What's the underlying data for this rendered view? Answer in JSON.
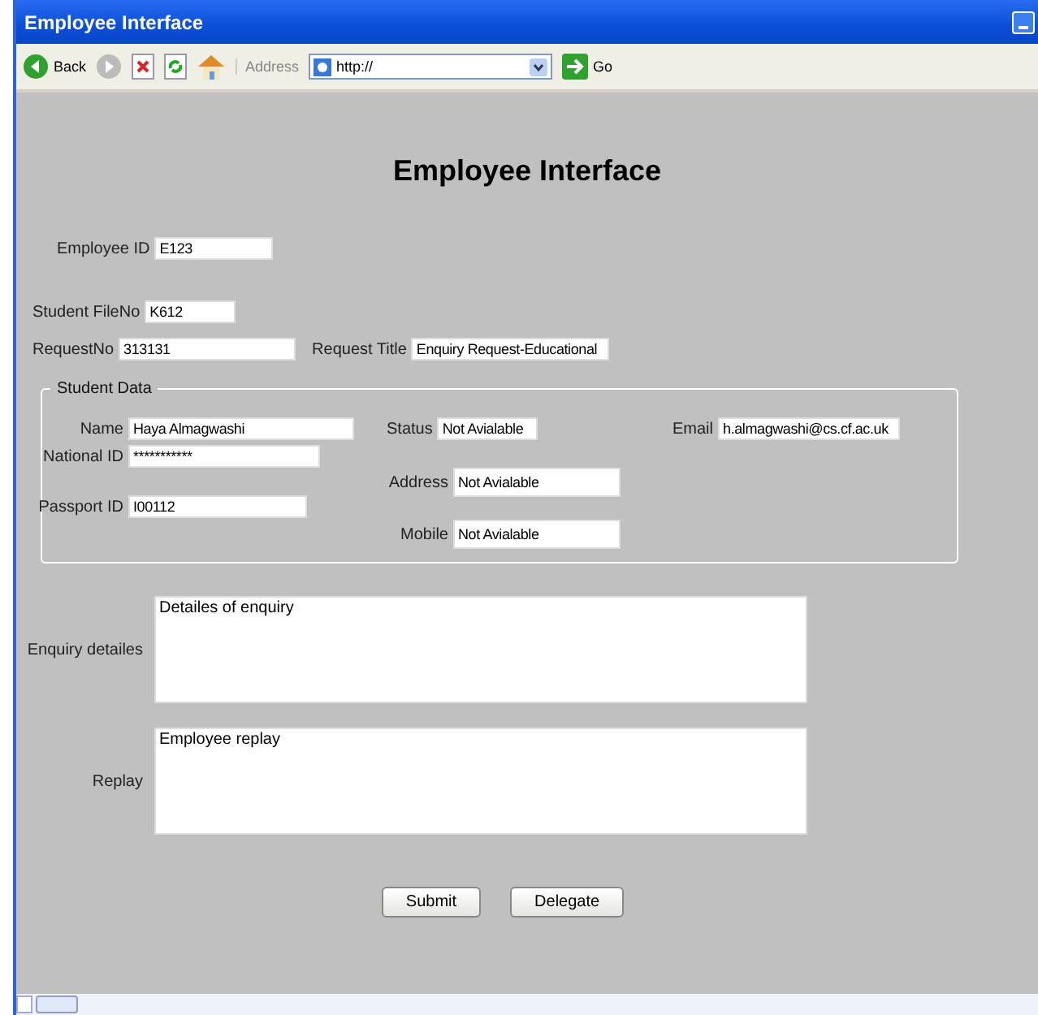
{
  "window": {
    "title": "Employee Interface"
  },
  "toolbar": {
    "back": "Back",
    "address_label": "Address",
    "address": "http://",
    "go": "Go"
  },
  "heading": "Employee Interface",
  "employee_id": {
    "label": "Employee ID",
    "value": "E123"
  },
  "student_file_no": {
    "label": "Student FileNo",
    "value": "K612"
  },
  "request_no": {
    "label": "RequestNo",
    "value": "313131"
  },
  "request_title": {
    "label": "Request Title",
    "value": "Enquiry Request-Educational"
  },
  "student_data": {
    "legend": "Student Data",
    "name": {
      "label": "Name",
      "value": "Haya Almagwashi"
    },
    "national_id": {
      "label": "National ID",
      "value": "***********"
    },
    "passport_id": {
      "label": "Passport ID",
      "value": "I00112"
    },
    "status": {
      "label": "Status",
      "value": "Not Avialable"
    },
    "address": {
      "label": "Address",
      "value": "Not Avialable"
    },
    "mobile": {
      "label": "Mobile",
      "value": "Not Avialable"
    },
    "email": {
      "label": "Email",
      "value": "h.almagwashi@cs.cf.ac.uk"
    }
  },
  "enquiry": {
    "label": "Enquiry detailes",
    "value": "Detailes of enquiry"
  },
  "replay": {
    "label": "Replay",
    "value": "Employee replay"
  },
  "buttons": [
    "Submit",
    "Delegate"
  ]
}
